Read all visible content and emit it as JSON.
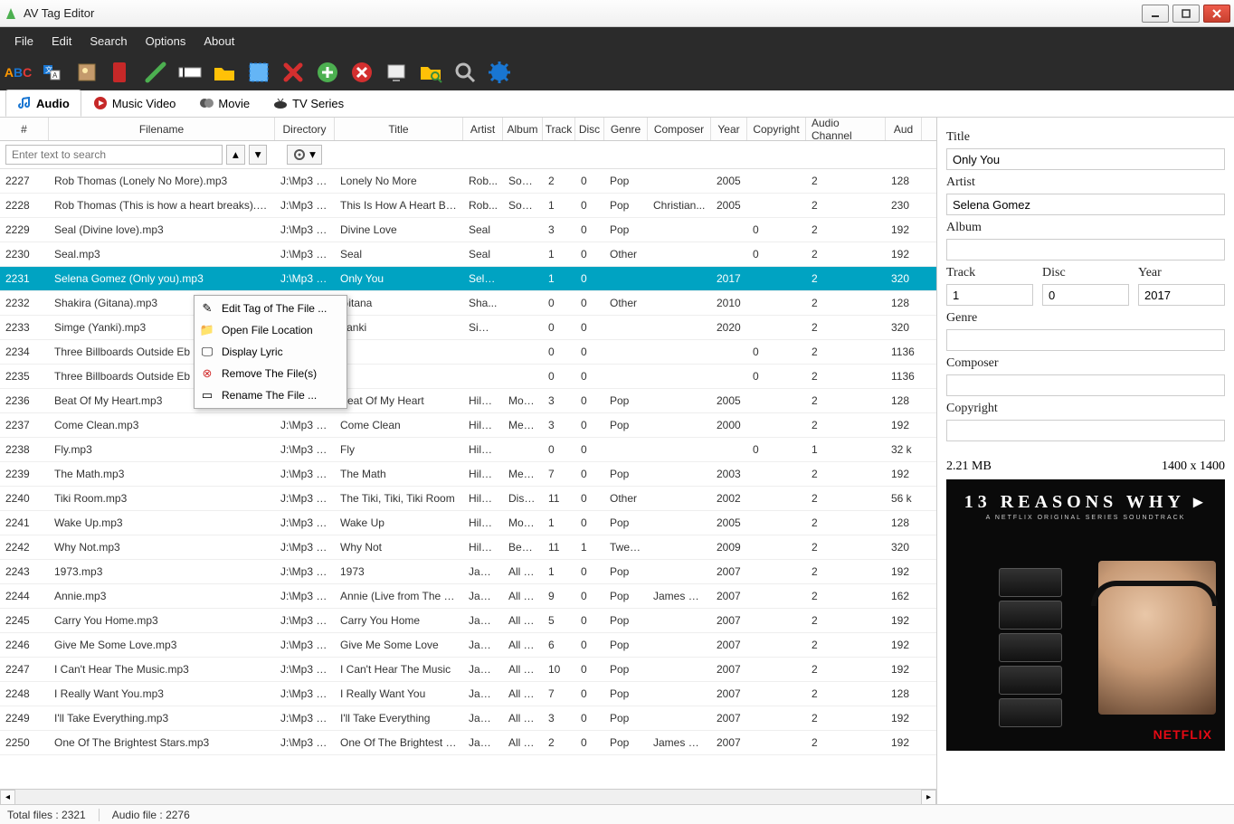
{
  "app": {
    "title": "AV Tag Editor"
  },
  "menus": {
    "file": "File",
    "edit": "Edit",
    "search": "Search",
    "options": "Options",
    "about": "About"
  },
  "tabs": {
    "audio": "Audio",
    "musicvideo": "Music Video",
    "movie": "Movie",
    "tvseries": "TV Series"
  },
  "columns": {
    "num": "#",
    "filename": "Filename",
    "directory": "Directory",
    "title": "Title",
    "artist": "Artist",
    "album": "Album",
    "track": "Track",
    "disc": "Disc",
    "genre": "Genre",
    "composer": "Composer",
    "year": "Year",
    "copyright": "Copyright",
    "audiochannel": "Audio Channel",
    "aud": "Aud"
  },
  "search_placeholder": "Enter text to search",
  "contextmenu": {
    "edit": "Edit Tag of The File ...",
    "open": "Open File Location",
    "lyric": "Display Lyric",
    "remove": "Remove The File(s)",
    "rename": "Rename The File ..."
  },
  "rows": [
    {
      "num": "2227",
      "fn": "Rob Thomas (Lonely No More).mp3",
      "dir": "J:\\Mp3 M...",
      "title": "Lonely No More",
      "art": "Rob...",
      "alb": "Some...",
      "trk": "2",
      "disc": "0",
      "gen": "Pop",
      "comp": "",
      "yr": "2005",
      "cpy": "",
      "ach": "2",
      "aud": "128"
    },
    {
      "num": "2228",
      "fn": "Rob Thomas (This is how a heart breaks).mp3",
      "dir": "J:\\Mp3 M...",
      "title": "This Is How A Heart Breaks",
      "art": "Rob...",
      "alb": "Some...",
      "trk": "1",
      "disc": "0",
      "gen": "Pop",
      "comp": "Christian...",
      "yr": "2005",
      "cpy": "",
      "ach": "2",
      "aud": "230"
    },
    {
      "num": "2229",
      "fn": "Seal (Divine love).mp3",
      "dir": "J:\\Mp3 M...",
      "title": "Divine Love",
      "art": "Seal",
      "alb": "",
      "trk": "3",
      "disc": "0",
      "gen": "Pop",
      "comp": "",
      "yr": "",
      "cpy": "0",
      "ach": "2",
      "aud": "192"
    },
    {
      "num": "2230",
      "fn": "Seal.mp3",
      "dir": "J:\\Mp3 M...",
      "title": "Seal",
      "art": "Seal",
      "alb": "",
      "trk": "1",
      "disc": "0",
      "gen": "Other",
      "comp": "",
      "yr": "",
      "cpy": "0",
      "ach": "2",
      "aud": "192"
    },
    {
      "num": "2231",
      "fn": "Selena Gomez (Only you).mp3",
      "dir": "J:\\Mp3 M...",
      "title": "Only You",
      "art": "Sele...",
      "alb": "",
      "trk": "1",
      "disc": "0",
      "gen": "",
      "comp": "",
      "yr": "2017",
      "cpy": "",
      "ach": "2",
      "aud": "320",
      "selected": true
    },
    {
      "num": "2232",
      "fn": "Shakira (Gitana).mp3",
      "dir": "",
      "title": "Gitana",
      "art": "Sha...",
      "alb": "",
      "trk": "0",
      "disc": "0",
      "gen": "Other",
      "comp": "",
      "yr": "2010",
      "cpy": "",
      "ach": "2",
      "aud": "128"
    },
    {
      "num": "2233",
      "fn": "Simge (Yanki).mp3",
      "dir": "",
      "title": "Yanki",
      "art": "Simge",
      "alb": "",
      "trk": "0",
      "disc": "0",
      "gen": "",
      "comp": "",
      "yr": "2020",
      "cpy": "",
      "ach": "2",
      "aud": "320"
    },
    {
      "num": "2234",
      "fn": "Three Billboards Outside Eb",
      "dir": "",
      "title": "",
      "art": "",
      "alb": "",
      "trk": "0",
      "disc": "0",
      "gen": "",
      "comp": "",
      "yr": "",
      "cpy": "0",
      "ach": "2",
      "aud": "1136"
    },
    {
      "num": "2235",
      "fn": "Three Billboards Outside Eb",
      "dir": "",
      "title": "",
      "art": "",
      "alb": "",
      "trk": "0",
      "disc": "0",
      "gen": "",
      "comp": "",
      "yr": "",
      "cpy": "0",
      "ach": "2",
      "aud": "1136"
    },
    {
      "num": "2236",
      "fn": "Beat Of My Heart.mp3",
      "dir": "J:\\Mp3 M...",
      "title": "Beat Of My Heart",
      "art": "Hilar...",
      "alb": "Most...",
      "trk": "3",
      "disc": "0",
      "gen": "Pop",
      "comp": "",
      "yr": "2005",
      "cpy": "",
      "ach": "2",
      "aud": "128"
    },
    {
      "num": "2237",
      "fn": "Come Clean.mp3",
      "dir": "J:\\Mp3 M...",
      "title": "Come Clean",
      "art": "Hilar...",
      "alb": "Meta...",
      "trk": "3",
      "disc": "0",
      "gen": "Pop",
      "comp": "",
      "yr": "2000",
      "cpy": "",
      "ach": "2",
      "aud": "192"
    },
    {
      "num": "2238",
      "fn": "Fly.mp3",
      "dir": "J:\\Mp3 M...",
      "title": "Fly",
      "art": "Hilar...",
      "alb": "",
      "trk": "0",
      "disc": "0",
      "gen": "",
      "comp": "",
      "yr": "",
      "cpy": "0",
      "ach": "1",
      "aud": "32 k"
    },
    {
      "num": "2239",
      "fn": "The Math.mp3",
      "dir": "J:\\Mp3 M...",
      "title": "The Math",
      "art": "Hilar...",
      "alb": "Meta...",
      "trk": "7",
      "disc": "0",
      "gen": "Pop",
      "comp": "",
      "yr": "2003",
      "cpy": "",
      "ach": "2",
      "aud": "192"
    },
    {
      "num": "2240",
      "fn": "Tiki Room.mp3",
      "dir": "J:\\Mp3 M...",
      "title": "The Tiki, Tiki, Tiki Room",
      "art": "Hilar...",
      "alb": "Disne...",
      "trk": "11",
      "disc": "0",
      "gen": "Other",
      "comp": "",
      "yr": "2002",
      "cpy": "",
      "ach": "2",
      "aud": "56 k"
    },
    {
      "num": "2241",
      "fn": "Wake Up.mp3",
      "dir": "J:\\Mp3 M...",
      "title": "Wake Up",
      "art": "Hilar...",
      "alb": "Most...",
      "trk": "1",
      "disc": "0",
      "gen": "Pop",
      "comp": "",
      "yr": "2005",
      "cpy": "",
      "ach": "2",
      "aud": "128"
    },
    {
      "num": "2242",
      "fn": "Why Not.mp3",
      "dir": "J:\\Mp3 M...",
      "title": "Why Not",
      "art": "Hilar...",
      "alb": "Best o...",
      "trk": "11",
      "disc": "1",
      "gen": "Twee...",
      "comp": "",
      "yr": "2009",
      "cpy": "",
      "ach": "2",
      "aud": "320"
    },
    {
      "num": "2243",
      "fn": "1973.mp3",
      "dir": "J:\\Mp3 M...",
      "title": "1973",
      "art": "Jam...",
      "alb": "All Th...",
      "trk": "1",
      "disc": "0",
      "gen": "Pop",
      "comp": "",
      "yr": "2007",
      "cpy": "",
      "ach": "2",
      "aud": "192"
    },
    {
      "num": "2244",
      "fn": "Annie.mp3",
      "dir": "J:\\Mp3 M...",
      "title": "Annie (Live from The Gar...",
      "art": "Jam...",
      "alb": "All Th...",
      "trk": "9",
      "disc": "0",
      "gen": "Pop",
      "comp": "James Blunt",
      "yr": "2007",
      "cpy": "",
      "ach": "2",
      "aud": "162"
    },
    {
      "num": "2245",
      "fn": "Carry You Home.mp3",
      "dir": "J:\\Mp3 M...",
      "title": "Carry You Home",
      "art": "Jam...",
      "alb": "All Th...",
      "trk": "5",
      "disc": "0",
      "gen": "Pop",
      "comp": "",
      "yr": "2007",
      "cpy": "",
      "ach": "2",
      "aud": "192"
    },
    {
      "num": "2246",
      "fn": "Give Me Some Love.mp3",
      "dir": "J:\\Mp3 M...",
      "title": "Give Me Some Love",
      "art": "Jam...",
      "alb": "All Th...",
      "trk": "6",
      "disc": "0",
      "gen": "Pop",
      "comp": "",
      "yr": "2007",
      "cpy": "",
      "ach": "2",
      "aud": "192"
    },
    {
      "num": "2247",
      "fn": "I Can't Hear The Music.mp3",
      "dir": "J:\\Mp3 M...",
      "title": "I Can't Hear The Music",
      "art": "Jam...",
      "alb": "All Th...",
      "trk": "10",
      "disc": "0",
      "gen": "Pop",
      "comp": "",
      "yr": "2007",
      "cpy": "",
      "ach": "2",
      "aud": "192"
    },
    {
      "num": "2248",
      "fn": "I Really Want You.mp3",
      "dir": "J:\\Mp3 M...",
      "title": "I Really Want You",
      "art": "Jam...",
      "alb": "All Th...",
      "trk": "7",
      "disc": "0",
      "gen": "Pop",
      "comp": "",
      "yr": "2007",
      "cpy": "",
      "ach": "2",
      "aud": "128"
    },
    {
      "num": "2249",
      "fn": "I'll Take Everything.mp3",
      "dir": "J:\\Mp3 M...",
      "title": "I'll Take Everything",
      "art": "Jam...",
      "alb": "All Th...",
      "trk": "3",
      "disc": "0",
      "gen": "Pop",
      "comp": "",
      "yr": "2007",
      "cpy": "",
      "ach": "2",
      "aud": "192"
    },
    {
      "num": "2250",
      "fn": "One Of The Brightest Stars.mp3",
      "dir": "J:\\Mp3 M...",
      "title": "One Of The Brightest Stars",
      "art": "Jam...",
      "alb": "All Th...",
      "trk": "2",
      "disc": "0",
      "gen": "Pop",
      "comp": "James Blunt",
      "yr": "2007",
      "cpy": "",
      "ach": "2",
      "aud": "192"
    }
  ],
  "details": {
    "labels": {
      "title": "Title",
      "artist": "Artist",
      "album": "Album",
      "track": "Track",
      "disc": "Disc",
      "year": "Year",
      "genre": "Genre",
      "composer": "Composer",
      "copyright": "Copyright"
    },
    "values": {
      "title": "Only You",
      "artist": "Selena Gomez",
      "album": "",
      "track": "1",
      "disc": "0",
      "year": "2017",
      "genre": "",
      "composer": "",
      "copyright": ""
    },
    "filesize": "2.21 MB",
    "resolution": "1400 x 1400",
    "cover": {
      "title": "13 REASONS WHY",
      "sub": "A NETFLIX ORIGINAL SERIES SOUNDTRACK",
      "brand": "NETFLIX"
    }
  },
  "status": {
    "total": "Total files : 2321",
    "audio": "Audio file : 2276"
  }
}
